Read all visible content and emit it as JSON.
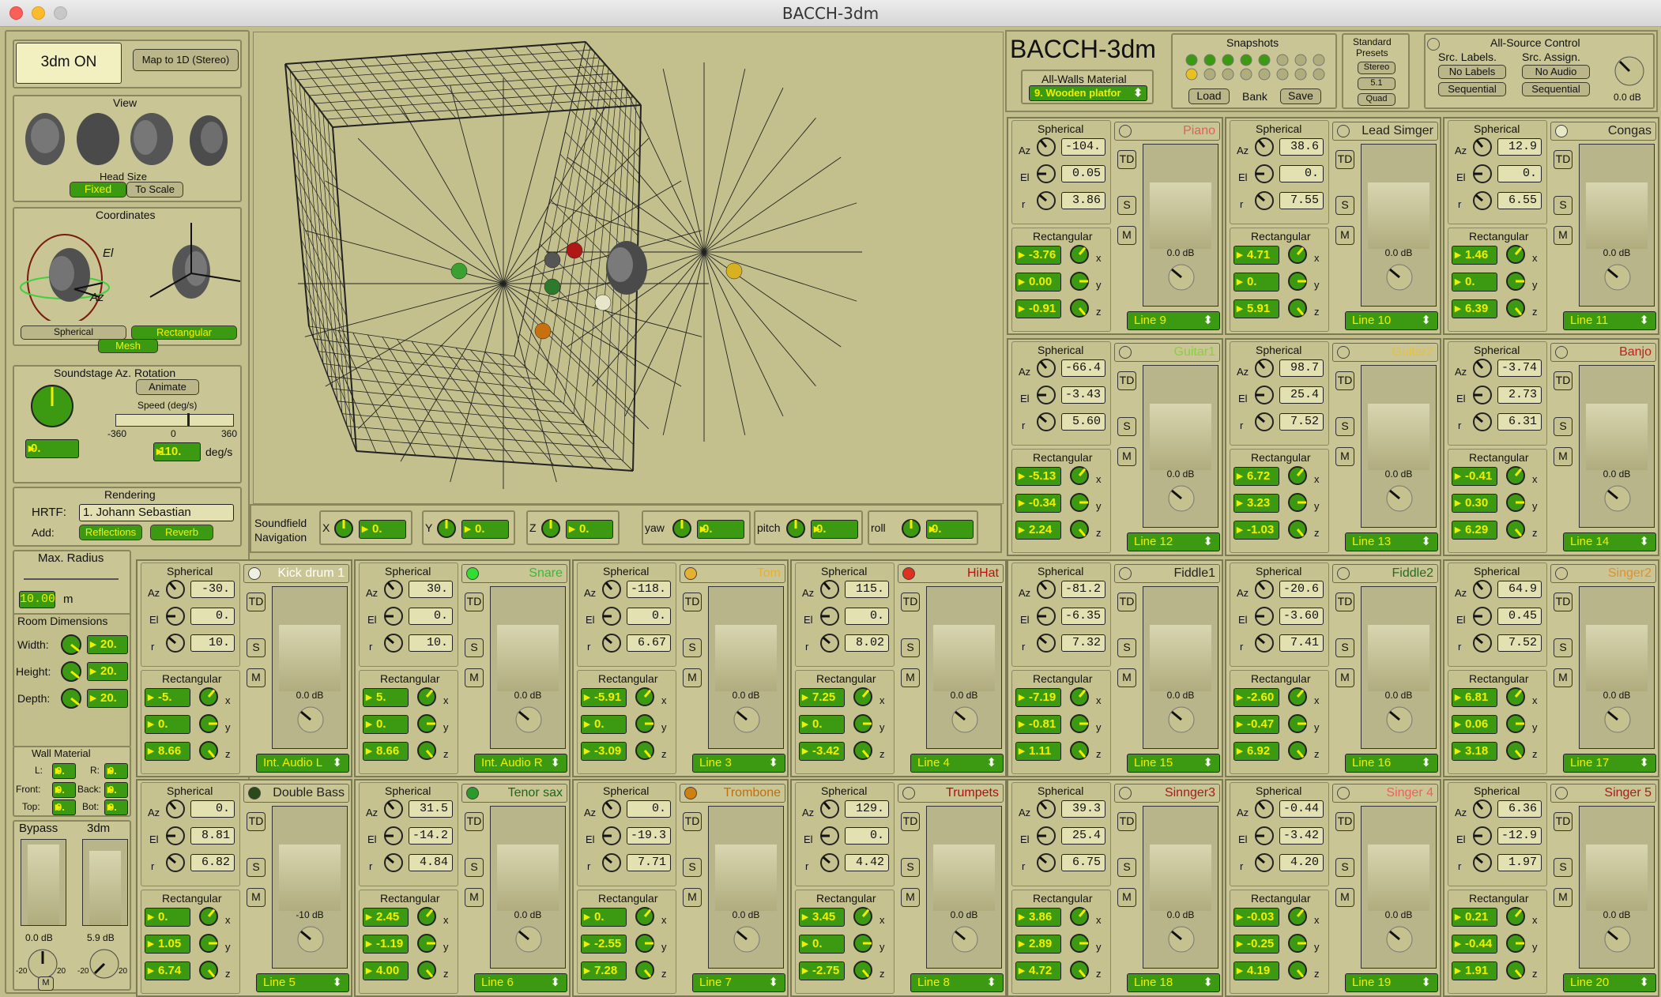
{
  "window": {
    "title": "BACCH-3dm"
  },
  "left": {
    "on_label": "3dm ON",
    "map_label": "Map to 1D (Stereo)",
    "view_title": "View",
    "head_size": "Head Size",
    "fixed": "Fixed",
    "to_scale": "To Scale",
    "coordinates": "Coordinates",
    "spherical": "Spherical",
    "rectangular": "Rectangular",
    "mesh": "Mesh",
    "el": "El",
    "az": "Az",
    "rotation_title": "Soundstage Az. Rotation",
    "animate": "Animate",
    "speed": "Speed (deg/s)",
    "speed_min": "-360",
    "speed_mid": "0",
    "speed_max": "360",
    "rotation_value": "0.",
    "speed_value": "110.",
    "speed_unit": "deg/s",
    "rendering": "Rendering",
    "hrtf_label": "HRTF:",
    "hrtf_value": "1. Johann Sebastian",
    "add_label": "Add:",
    "reflections": "Reflections",
    "reverb": "Reverb",
    "max_radius": "Max. Radius",
    "max_radius_value": "10.00",
    "max_radius_unit": "m",
    "room_dims": "Room Dimensions",
    "width_label": "Width:",
    "height_label": "Height:",
    "depth_label": "Depth:",
    "width_value": "20.",
    "height_value": "20.",
    "depth_value": "20.",
    "wall_material": "Wall Material",
    "wm_l": "L:",
    "wm_r": "R:",
    "wm_front": "Front:",
    "wm_back": "Back:",
    "wm_top": "Top:",
    "wm_bot": "Bot:",
    "wm_val": "9.",
    "bypass": "Bypass",
    "threedm": "3dm",
    "bypass_db": "0.0 dB",
    "threedm_db": "5.9 dB",
    "scale_min": "-20",
    "scale_max": "20",
    "m": "M"
  },
  "nav": {
    "title1": "Soundfield",
    "title2": "Navigation",
    "x": "X",
    "y": "Y",
    "z": "Z",
    "yaw": "yaw",
    "pitch": "pitch",
    "roll": "roll",
    "x_val": "0.",
    "y_val": "0.",
    "z_val": "0.",
    "yaw_val": "0.",
    "pitch_val": "0.",
    "roll_val": "0."
  },
  "header": {
    "title": "BACCH-3dm",
    "walls_label": "All-Walls Material",
    "walls_value": "9. Wooden platfor",
    "snapshots": "Snapshots",
    "load": "Load",
    "bank": "Bank",
    "save": "Save",
    "standard": "Standard",
    "presets": "Presets",
    "stereo": "Stereo",
    "five_one": "5.1",
    "quad": "Quad",
    "all_source": "All-Source Control",
    "src_labels": "Src. Labels.",
    "src_assign": "Src. Assign.",
    "no_labels": "No Labels",
    "no_audio": "No Audio",
    "sequential": "Sequential",
    "master_db": "0.0 dB"
  },
  "strings": {
    "spherical": "Spherical",
    "rectangular": "Rectangular",
    "az": "Az",
    "el": "El",
    "r": "r",
    "x": "x",
    "y": "y",
    "z": "z",
    "td": "TD",
    "s": "S",
    "m": "M"
  },
  "sources": [
    {
      "name": "Piano",
      "color": "#e06060",
      "dot": "#c9c594",
      "az": "-104.",
      "el": "0.05",
      "r": "3.86",
      "x": "-3.76",
      "y": "0.00",
      "z": "-0.91",
      "db": "0.0 dB",
      "line": "Line 9"
    },
    {
      "name": "Lead Simger",
      "color": "#222",
      "dot": "#c9c594",
      "az": "38.6",
      "el": "0.",
      "r": "7.55",
      "x": "4.71",
      "y": "0.",
      "z": "5.91",
      "db": "0.0 dB",
      "line": "Line 10"
    },
    {
      "name": "Congas",
      "color": "#222",
      "dot": "#e8e8c8",
      "az": "12.9",
      "el": "0.",
      "r": "6.55",
      "x": "1.46",
      "y": "0.",
      "z": "6.39",
      "db": "0.0 dB",
      "line": "Line 11"
    },
    {
      "name": "Guitar1",
      "color": "#8ad040",
      "dot": "#c9c594",
      "az": "-66.4",
      "el": "-3.43",
      "r": "5.60",
      "x": "-5.13",
      "y": "-0.34",
      "z": "2.24",
      "db": "0.0 dB",
      "line": "Line 12"
    },
    {
      "name": "Guitar2",
      "color": "#e8c040",
      "dot": "#c9c594",
      "az": "98.7",
      "el": "25.4",
      "r": "7.52",
      "x": "6.72",
      "y": "3.23",
      "z": "-1.03",
      "db": "0.0 dB",
      "line": "Line 13"
    },
    {
      "name": "Banjo",
      "color": "#c02020",
      "dot": "#c9c594",
      "az": "-3.74",
      "el": "2.73",
      "r": "6.31",
      "x": "-0.41",
      "y": "0.30",
      "z": "6.29",
      "db": "0.0 dB",
      "line": "Line 14"
    },
    {
      "name": "Kick drum 1",
      "color": "#fff",
      "dot": "#f0f0e0",
      "az": "-30.",
      "el": "0.",
      "r": "10.",
      "x": "-5.",
      "y": "0.",
      "z": "8.66",
      "db": "0.0 dB",
      "line": "Int. Audio L"
    },
    {
      "name": "Snare",
      "color": "#30c030",
      "dot": "#30e030",
      "az": "30.",
      "el": "0.",
      "r": "10.",
      "x": "5.",
      "y": "0.",
      "z": "8.66",
      "db": "0.0 dB",
      "line": "Int. Audio R"
    },
    {
      "name": "Tom",
      "color": "#e8b030",
      "dot": "#e8b030",
      "az": "-118.",
      "el": "0.",
      "r": "6.67",
      "x": "-5.91",
      "y": "0.",
      "z": "-3.09",
      "db": "0.0 dB",
      "line": "Line 3"
    },
    {
      "name": "HiHat",
      "color": "#c01010",
      "dot": "#e03020",
      "az": "115.",
      "el": "0.",
      "r": "8.02",
      "x": "7.25",
      "y": "0.",
      "z": "-3.42",
      "db": "0.0 dB",
      "line": "Line 4"
    },
    {
      "name": "Fiddle1",
      "color": "#222",
      "dot": "#c9c594",
      "az": "-81.2",
      "el": "-6.35",
      "r": "7.32",
      "x": "-7.19",
      "y": "-0.81",
      "z": "1.11",
      "db": "0.0 dB",
      "line": "Line 15"
    },
    {
      "name": "Fiddle2",
      "color": "#2a6a20",
      "dot": "#c9c594",
      "az": "-20.6",
      "el": "-3.60",
      "r": "7.41",
      "x": "-2.60",
      "y": "-0.47",
      "z": "6.92",
      "db": "0.0 dB",
      "line": "Line 16"
    },
    {
      "name": "Singer2",
      "color": "#e09030",
      "dot": "#c9c594",
      "az": "64.9",
      "el": "0.45",
      "r": "7.52",
      "x": "6.81",
      "y": "0.06",
      "z": "3.18",
      "db": "0.0 dB",
      "line": "Line 17"
    },
    {
      "name": "Double Bass",
      "color": "#222",
      "dot": "#2a4a1a",
      "az": "0.",
      "el": "8.81",
      "r": "6.82",
      "x": "0.",
      "y": "1.05",
      "z": "6.74",
      "db": "-10 dB",
      "line": "Line 5"
    },
    {
      "name": "Tenor sax",
      "color": "#1a6a1a",
      "dot": "#2a9a2a",
      "az": "31.5",
      "el": "-14.2",
      "r": "4.84",
      "x": "2.45",
      "y": "-1.19",
      "z": "4.00",
      "db": "0.0 dB",
      "line": "Line 6"
    },
    {
      "name": "Trombone",
      "color": "#c07010",
      "dot": "#d08010",
      "az": "0.",
      "el": "-19.3",
      "r": "7.71",
      "x": "0.",
      "y": "-2.55",
      "z": "7.28",
      "db": "0.0 dB",
      "line": "Line 7"
    },
    {
      "name": "Trumpets",
      "color": "#b01010",
      "dot": "#c9c594",
      "az": "129.",
      "el": "0.",
      "r": "4.42",
      "x": "3.45",
      "y": "0.",
      "z": "-2.75",
      "db": "0.0 dB",
      "line": "Line 8"
    },
    {
      "name": "Sinnger3",
      "color": "#a02020",
      "dot": "#c9c594",
      "az": "39.3",
      "el": "25.4",
      "r": "6.75",
      "x": "3.86",
      "y": "2.89",
      "z": "4.72",
      "db": "0.0 dB",
      "line": "Line 18"
    },
    {
      "name": "Singer 4",
      "color": "#f06060",
      "dot": "#c9c594",
      "az": "-0.44",
      "el": "-3.42",
      "r": "4.20",
      "x": "-0.03",
      "y": "-0.25",
      "z": "4.19",
      "db": "0.0 dB",
      "line": "Line 19"
    },
    {
      "name": "Singer 5",
      "color": "#a02020",
      "dot": "#c9c594",
      "az": "6.36",
      "el": "-12.9",
      "r": "1.97",
      "x": "0.21",
      "y": "-0.44",
      "z": "1.91",
      "db": "0.0 dB",
      "line": "Line 20"
    }
  ]
}
